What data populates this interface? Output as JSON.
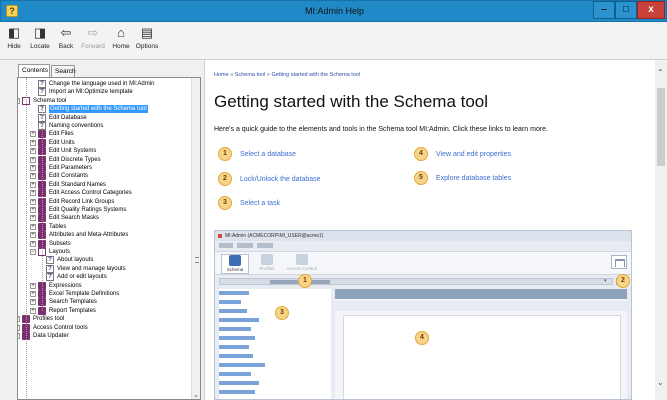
{
  "window": {
    "title": "MI:Admin Help",
    "min_label": "–",
    "max_label": "□",
    "close_label": "x"
  },
  "toolbar": {
    "hide": "Hide",
    "locate": "Locate",
    "back": "Back",
    "forward": "Forward",
    "home": "Home",
    "options": "Options"
  },
  "nav_tabs": {
    "contents": "Contents",
    "search": "Search"
  },
  "tree": [
    {
      "label": "Change the language used in MI:Admin",
      "icon": "page-icon",
      "indent": 2
    },
    {
      "label": "Import an MI:Optimize template",
      "icon": "page-icon",
      "indent": 2
    },
    {
      "label": "Schema tool",
      "icon": "book-open-icon",
      "indent": 1,
      "expander": "−"
    },
    {
      "label": "Getting started with the Schema tool",
      "icon": "page-icon",
      "indent": 2,
      "selected": true
    },
    {
      "label": "Edit Database",
      "icon": "page-icon",
      "indent": 2
    },
    {
      "label": "Naming conventions",
      "icon": "page-icon",
      "indent": 2
    },
    {
      "label": "Edit Files",
      "icon": "book-icon",
      "indent": 2,
      "expander": "+"
    },
    {
      "label": "Edit Units",
      "icon": "book-icon",
      "indent": 2,
      "expander": "+"
    },
    {
      "label": "Edit Unit Systems",
      "icon": "book-icon",
      "indent": 2,
      "expander": "+"
    },
    {
      "label": "Edit Discrete Types",
      "icon": "book-icon",
      "indent": 2,
      "expander": "+"
    },
    {
      "label": "Edit Parameters",
      "icon": "book-icon",
      "indent": 2,
      "expander": "+"
    },
    {
      "label": "Edit Constants",
      "icon": "book-icon",
      "indent": 2,
      "expander": "+"
    },
    {
      "label": "Edit Standard Names",
      "icon": "book-icon",
      "indent": 2,
      "expander": "+"
    },
    {
      "label": "Edit Access Control Categories",
      "icon": "book-icon",
      "indent": 2,
      "expander": "+"
    },
    {
      "label": "Edit Record Link Groups",
      "icon": "book-icon",
      "indent": 2,
      "expander": "+"
    },
    {
      "label": "Edit Quality Ratings Systems",
      "icon": "book-icon",
      "indent": 2,
      "expander": "+"
    },
    {
      "label": "Edit Search Masks",
      "icon": "book-icon",
      "indent": 2,
      "expander": "+"
    },
    {
      "label": "Tables",
      "icon": "book-icon",
      "indent": 2,
      "expander": "+"
    },
    {
      "label": "Attributes and Meta-Attributes",
      "icon": "book-icon",
      "indent": 2,
      "expander": "+"
    },
    {
      "label": "Subsets",
      "icon": "book-icon",
      "indent": 2,
      "expander": "+"
    },
    {
      "label": "Layouts",
      "icon": "book-open-icon",
      "indent": 2,
      "expander": "−"
    },
    {
      "label": "About layouts",
      "icon": "page-icon",
      "indent": 3
    },
    {
      "label": "View and manage layouts",
      "icon": "page-icon",
      "indent": 3
    },
    {
      "label": "Add or edit layouts",
      "icon": "page-icon",
      "indent": 3
    },
    {
      "label": "Expressions",
      "icon": "book-icon",
      "indent": 2,
      "expander": "+"
    },
    {
      "label": "Excel Template Definitions",
      "icon": "book-icon",
      "indent": 2,
      "expander": "+"
    },
    {
      "label": "Search Templates",
      "icon": "book-icon",
      "indent": 2,
      "expander": "+"
    },
    {
      "label": "Report Templates",
      "icon": "book-icon",
      "indent": 2,
      "expander": "+"
    },
    {
      "label": "Profiles tool",
      "icon": "book-icon",
      "indent": 1,
      "expander": "+"
    },
    {
      "label": "Access Control tools",
      "icon": "book-icon",
      "indent": 1,
      "expander": "+"
    },
    {
      "label": "Data Updater",
      "icon": "book-icon",
      "indent": 1,
      "expander": "+"
    }
  ],
  "content": {
    "breadcrumb": {
      "home": "Home",
      "sep1": " » ",
      "section": "Schema tool",
      "sep2": " » ",
      "current": "Getting started with the Schema tool"
    },
    "heading": "Getting started with the Schema tool",
    "intro": "Here's a quick guide to the elements and tools in the Schema tool MI:Admin. Click these links to learn more.",
    "links": [
      {
        "num": "1",
        "label": "Select a database"
      },
      {
        "num": "2",
        "label": "Lock/Unlock the database"
      },
      {
        "num": "3",
        "label": "Select a task"
      },
      {
        "num": "4",
        "label": "View and edit properties"
      },
      {
        "num": "5",
        "label": "Explore database tables"
      }
    ],
    "screenshot": {
      "title": "MI:Admin (ACMECORP\\MI_USER@acme1)",
      "buttons": [
        "Schema",
        "Profiles",
        "Access Control"
      ],
      "callouts": [
        "1",
        "2",
        "3",
        "4"
      ]
    }
  },
  "colors": {
    "titlebar": "#1f8ac7",
    "link": "#3c6fd1",
    "selected": "#3399ff",
    "callout": "#f7d489"
  }
}
